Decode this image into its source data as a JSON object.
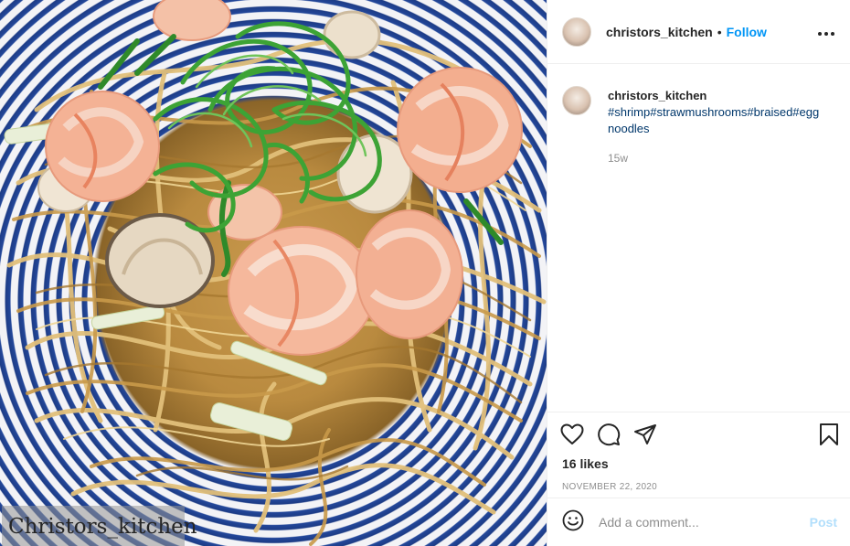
{
  "post": {
    "image_alt": "Braised egg noodles with shrimp, straw mushrooms and scallions",
    "watermark": "Christors_kitchen"
  },
  "header": {
    "username": "christors_kitchen",
    "separator": "•",
    "follow_label": "Follow",
    "more_label": "•••"
  },
  "caption": {
    "username": "christors_kitchen",
    "hashtags": "#shrimp#strawmushrooms#braised#eggnoodles",
    "time_ago": "15w"
  },
  "actions": {
    "likes": "16 likes",
    "date": "NOVEMBER 22, 2020"
  },
  "comment": {
    "placeholder": "Add a comment...",
    "post_label": "Post",
    "post_color": "#b2dffc"
  },
  "colors": {
    "link_blue": "#0095f6",
    "hashtag_blue": "#00376b",
    "muted": "#8e8e8e",
    "border": "#efefef"
  }
}
